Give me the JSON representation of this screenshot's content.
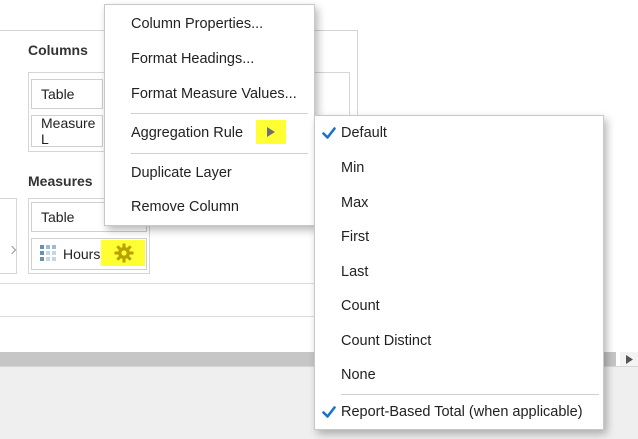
{
  "layout": {
    "columns_title": "Columns",
    "measures_title": "Measures",
    "columns_cells": [
      "Table",
      "Measure L"
    ],
    "measures_cells": [
      "Table",
      "Hours"
    ]
  },
  "context_menu": {
    "items": [
      {
        "label": "Column Properties..."
      },
      {
        "label": "Format Headings..."
      },
      {
        "label": "Format Measure Values..."
      },
      {
        "label": "Aggregation Rule"
      },
      {
        "label": "Duplicate Layer"
      },
      {
        "label": "Remove Column"
      }
    ]
  },
  "aggregation_submenu": {
    "items": [
      {
        "label": "Default",
        "checked": true
      },
      {
        "label": "Min",
        "checked": false
      },
      {
        "label": "Max",
        "checked": false
      },
      {
        "label": "First",
        "checked": false
      },
      {
        "label": "Last",
        "checked": false
      },
      {
        "label": "Count",
        "checked": false
      },
      {
        "label": "Count Distinct",
        "checked": false
      },
      {
        "label": "None",
        "checked": false
      },
      {
        "label": "Report-Based Total (when applicable)",
        "checked": true
      }
    ]
  },
  "colors": {
    "highlight": "#ffff33",
    "check": "#1a73c9",
    "gear": "#b8a200"
  },
  "icons": [
    "hours-measure-icon",
    "gear-icon",
    "submenu-arrow-icon",
    "check-icon",
    "scroll-right-icon"
  ]
}
